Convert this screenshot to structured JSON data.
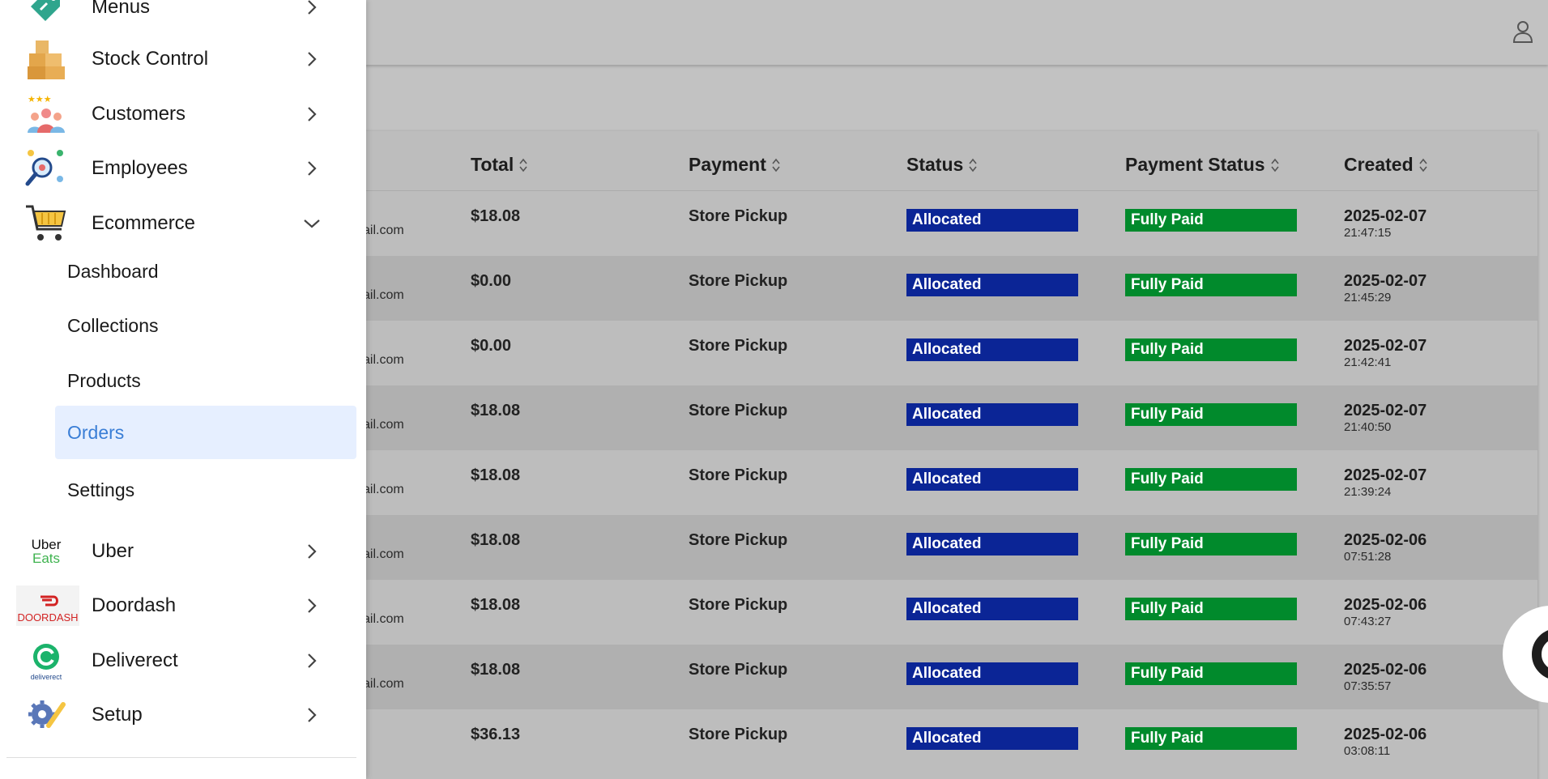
{
  "colors": {
    "status_allocated": "#0b2596",
    "payment_fully_paid": "#018a2c",
    "active_item_bg": "#e6efff",
    "active_item_text": "#3a7ed6"
  },
  "header": {
    "user_icon": "person-outline-icon"
  },
  "sidebar": {
    "items": [
      {
        "label": "Menus",
        "icon": "tag-link-icon"
      },
      {
        "label": "Stock Control",
        "icon": "boxes-icon"
      },
      {
        "label": "Customers",
        "icon": "customers-stars-icon"
      },
      {
        "label": "Employees",
        "icon": "employees-search-icon"
      },
      {
        "label": "Ecommerce",
        "icon": "shopping-cart-icon"
      },
      {
        "label": "Uber",
        "icon": "uber-eats-logo",
        "logo_top": "Uber",
        "logo_bottom": "Eats"
      },
      {
        "label": "Doordash",
        "icon": "doordash-logo",
        "logo_text": "DOORDASH"
      },
      {
        "label": "Deliverect",
        "icon": "deliverect-logo",
        "logo_text": "deliverect"
      },
      {
        "label": "Setup",
        "icon": "gear-wrench-icon"
      }
    ],
    "ecommerce_sub": [
      {
        "label": "Dashboard"
      },
      {
        "label": "Collections"
      },
      {
        "label": "Products"
      },
      {
        "label": "Orders",
        "active": true
      },
      {
        "label": "Settings"
      }
    ]
  },
  "table": {
    "columns": [
      "Total",
      "Payment",
      "Status",
      "Payment Status",
      "Created"
    ],
    "rows": [
      {
        "email": "ail.com",
        "total": "$18.08",
        "payment": "Store Pickup",
        "status": "Allocated",
        "payment_status": "Fully Paid",
        "date": "2025-02-07",
        "time": "21:47:15"
      },
      {
        "email": "ail.com",
        "total": "$0.00",
        "payment": "Store Pickup",
        "status": "Allocated",
        "payment_status": "Fully Paid",
        "date": "2025-02-07",
        "time": "21:45:29"
      },
      {
        "email": "ail.com",
        "total": "$0.00",
        "payment": "Store Pickup",
        "status": "Allocated",
        "payment_status": "Fully Paid",
        "date": "2025-02-07",
        "time": "21:42:41"
      },
      {
        "email": "ail.com",
        "total": "$18.08",
        "payment": "Store Pickup",
        "status": "Allocated",
        "payment_status": "Fully Paid",
        "date": "2025-02-07",
        "time": "21:40:50"
      },
      {
        "email": "ail.com",
        "total": "$18.08",
        "payment": "Store Pickup",
        "status": "Allocated",
        "payment_status": "Fully Paid",
        "date": "2025-02-07",
        "time": "21:39:24"
      },
      {
        "email": "ail.com",
        "total": "$18.08",
        "payment": "Store Pickup",
        "status": "Allocated",
        "payment_status": "Fully Paid",
        "date": "2025-02-06",
        "time": "07:51:28"
      },
      {
        "email": "ail.com",
        "total": "$18.08",
        "payment": "Store Pickup",
        "status": "Allocated",
        "payment_status": "Fully Paid",
        "date": "2025-02-06",
        "time": "07:43:27"
      },
      {
        "email": "ail.com",
        "total": "$18.08",
        "payment": "Store Pickup",
        "status": "Allocated",
        "payment_status": "Fully Paid",
        "date": "2025-02-06",
        "time": "07:35:57"
      },
      {
        "email": "",
        "total": "$36.13",
        "payment": "Store Pickup",
        "status": "Allocated",
        "payment_status": "Fully Paid",
        "date": "2025-02-06",
        "time": "03:08:11"
      }
    ]
  },
  "fab": {
    "icon": "support-chat-icon"
  }
}
